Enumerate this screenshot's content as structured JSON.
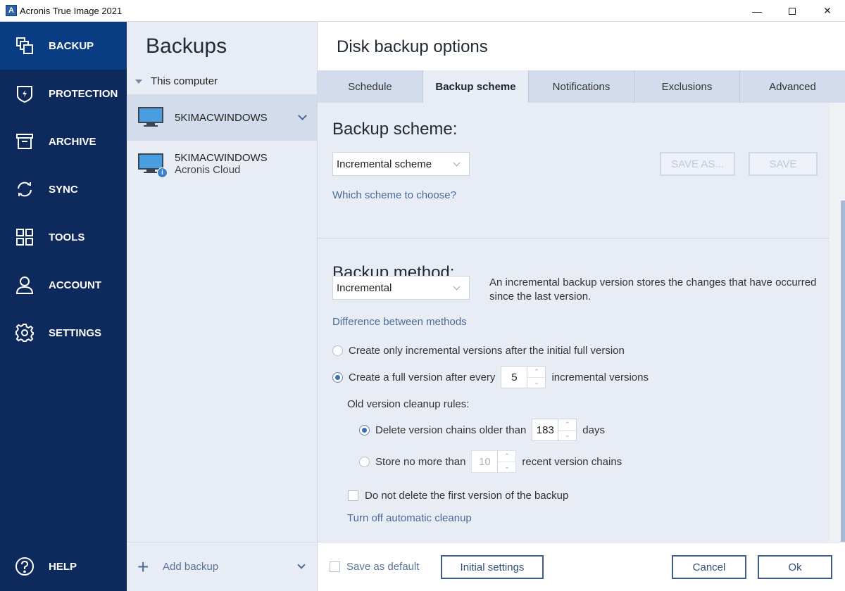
{
  "window": {
    "title": "Acronis True Image 2021",
    "controls": [
      "minimize",
      "maximize",
      "close"
    ]
  },
  "sidebar": {
    "items": [
      {
        "label": "BACKUP",
        "icon": "backup-icon",
        "active": true
      },
      {
        "label": "PROTECTION",
        "icon": "shield-icon",
        "active": false
      },
      {
        "label": "ARCHIVE",
        "icon": "archive-icon",
        "active": false
      },
      {
        "label": "SYNC",
        "icon": "sync-icon",
        "active": false
      },
      {
        "label": "TOOLS",
        "icon": "tools-grid-icon",
        "active": false
      },
      {
        "label": "ACCOUNT",
        "icon": "user-icon",
        "active": false
      },
      {
        "label": "SETTINGS",
        "icon": "gear-icon",
        "active": false
      }
    ],
    "help": {
      "label": "HELP",
      "icon": "help-icon"
    }
  },
  "backups": {
    "title": "Backups",
    "group": "This computer",
    "items": [
      {
        "name": "5KIMACWINDOWS",
        "sub": "",
        "selected": true
      },
      {
        "name": "5KIMACWINDOWS",
        "sub": "Acronis Cloud",
        "selected": false
      }
    ],
    "add_label": "Add backup"
  },
  "main": {
    "title": "Disk backup options",
    "tabs": [
      {
        "label": "Schedule",
        "active": false
      },
      {
        "label": "Backup scheme",
        "active": true
      },
      {
        "label": "Notifications",
        "active": false
      },
      {
        "label": "Exclusions",
        "active": false
      },
      {
        "label": "Advanced",
        "active": false
      }
    ],
    "scheme": {
      "heading": "Backup scheme:",
      "selected": "Incremental scheme",
      "save_as": "SAVE AS...",
      "save": "SAVE",
      "help_link": "Which scheme to choose?"
    },
    "method": {
      "heading": "Backup method:",
      "selected": "Incremental",
      "description": "An incremental backup version stores the changes that have occurred since the last version.",
      "help_link": "Difference between methods",
      "option_only_incremental": "Create only incremental versions after the initial full version",
      "option_full_after_prefix": "Create a full version after every",
      "full_after_value": "5",
      "option_full_after_suffix": "incremental versions",
      "selected_option": "full_after"
    },
    "cleanup": {
      "heading": "Old version cleanup rules:",
      "delete_older_prefix": "Delete version chains older than",
      "delete_older_value": "183",
      "delete_older_suffix": "days",
      "store_max_prefix": "Store no more than",
      "store_max_value": "10",
      "store_max_suffix": "recent version chains",
      "selected_option": "delete_older",
      "keep_first_label": "Do not delete the first version of the backup",
      "keep_first_checked": false,
      "turn_off_link": "Turn off automatic cleanup"
    },
    "footer": {
      "save_default_label": "Save as default",
      "save_default_checked": false,
      "initial_settings": "Initial settings",
      "cancel": "Cancel",
      "ok": "Ok"
    }
  },
  "colors": {
    "sidebar_bg": "#0e2a5c",
    "sidebar_active": "#0a3c84",
    "panel_bg": "#e8ecf4",
    "tab_bg": "#d2dced",
    "link": "#4a6a9a",
    "accent": "#3a6fb5"
  }
}
